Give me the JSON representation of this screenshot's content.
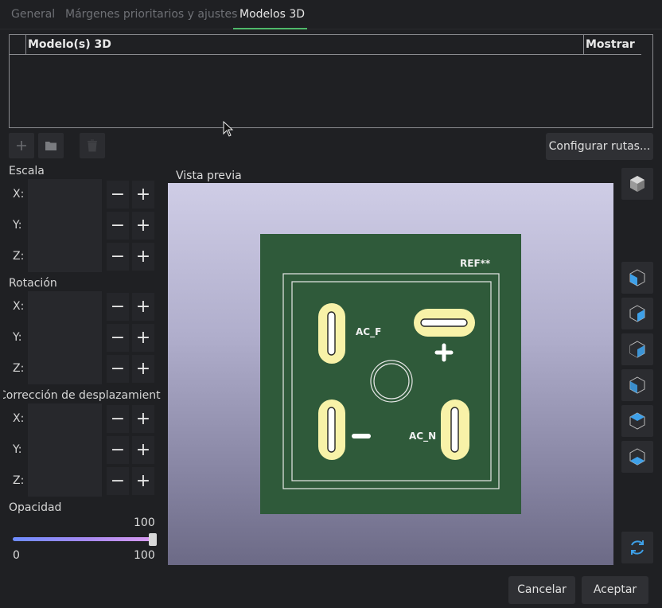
{
  "tabs": [
    {
      "label": "General"
    },
    {
      "label": "Márgenes prioritarios y ajustes"
    },
    {
      "label": "Modelos 3D"
    }
  ],
  "models_table": {
    "columns": [
      "Modelo(s) 3D",
      "Mostrar"
    ]
  },
  "toolbar": {
    "configure_paths": "Configurar rutas..."
  },
  "groups": {
    "scale": {
      "title": "Escala",
      "axes": [
        "X:",
        "Y:",
        "Z:"
      ]
    },
    "rotation": {
      "title": "Rotación",
      "axes": [
        "X:",
        "Y:",
        "Z:"
      ]
    },
    "offset": {
      "title": "Corrección de desplazamiento",
      "axes": [
        "X:",
        "Y:",
        "Z:"
      ]
    }
  },
  "stepper": {
    "minus": "−",
    "plus": "+"
  },
  "opacity": {
    "title": "Opacidad",
    "value": "100",
    "min": "0",
    "max": "100",
    "fraction": 1.0
  },
  "preview": {
    "title": "Vista previa",
    "board_labels": {
      "ref": "REF**",
      "ac_f": "AC_F",
      "ac_n": "AC_N"
    }
  },
  "colors": {
    "accent_green": "#4fb96a",
    "board_green": "#2f5a3a",
    "pad_yellow": "#f8f2a8",
    "view_icon_blue": "#3ea0e8"
  },
  "footer": {
    "cancel": "Cancelar",
    "accept": "Aceptar"
  }
}
